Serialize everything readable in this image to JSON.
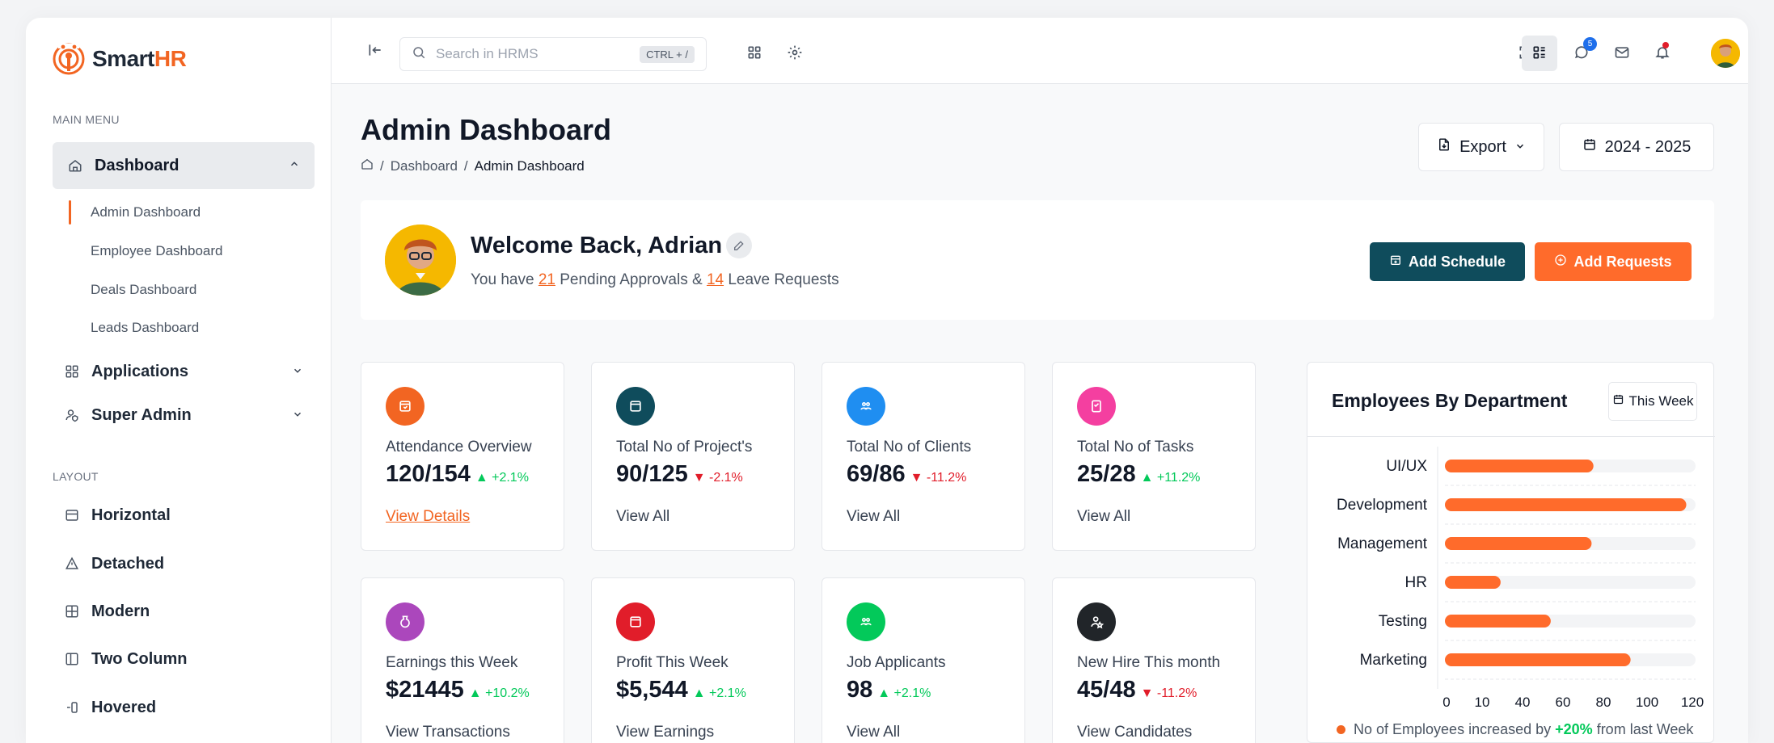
{
  "app": {
    "name_part1": "Smart",
    "name_part2": "HR"
  },
  "sidebar": {
    "main_menu_label": "MAIN MENU",
    "dashboard_label": "Dashboard",
    "dashboard_sub": [
      "Admin Dashboard",
      "Employee Dashboard",
      "Deals Dashboard",
      "Leads Dashboard"
    ],
    "applications_label": "Applications",
    "super_admin_label": "Super Admin",
    "layout_label": "LAYOUT",
    "layout_items": [
      "Horizontal",
      "Detached",
      "Modern",
      "Two Column",
      "Hovered"
    ]
  },
  "topbar": {
    "search_placeholder": "Search in HRMS",
    "search_shortcut": "CTRL + /",
    "chat_badge": "5"
  },
  "header": {
    "title": "Admin Dashboard",
    "breadcrumb": [
      "Dashboard",
      "Admin Dashboard"
    ],
    "export_label": "Export",
    "year_label": "2024 - 2025"
  },
  "welcome": {
    "title": "Welcome Back, Adrian",
    "sub_prefix": "You have ",
    "pending_count": "21",
    "sub_mid": " Pending Approvals & ",
    "leave_count": "14",
    "sub_suffix": " Leave Requests",
    "add_schedule": "Add Schedule",
    "add_requests": "Add Requests"
  },
  "cards": [
    {
      "label": "Attendance Overview",
      "value": "120/154",
      "trend": "+2.1%",
      "direction": "up",
      "link": "View Details",
      "color": "#f26522"
    },
    {
      "label": "Total No of Project's",
      "value": "90/125",
      "trend": "-2.1%",
      "direction": "down",
      "link": "View All",
      "color": "#0f4c5c"
    },
    {
      "label": "Total No of Clients",
      "value": "69/86",
      "trend": "-11.2%",
      "direction": "down",
      "link": "View All",
      "color": "#1f8ef1"
    },
    {
      "label": "Total No of Tasks",
      "value": "25/28",
      "trend": "+11.2%",
      "direction": "up",
      "link": "View All",
      "color": "#f43fa0"
    },
    {
      "label": "Earnings this Week",
      "value": "$21445",
      "trend": "+10.2%",
      "direction": "up",
      "link": "View Transactions",
      "color": "#ab47bc"
    },
    {
      "label": "Profit This Week",
      "value": "$5,544",
      "trend": "+2.1%",
      "direction": "up",
      "link": "View Earnings",
      "color": "#e11d2a"
    },
    {
      "label": "Job Applicants",
      "value": "98",
      "trend": "+2.1%",
      "direction": "up",
      "link": "View All",
      "color": "#03c95a"
    },
    {
      "label": "New Hire This month",
      "value": "45/48",
      "trend": "-11.2%",
      "direction": "down",
      "link": "View Candidates",
      "color": "#212529"
    }
  ],
  "chart_data": {
    "type": "bar",
    "orientation": "horizontal",
    "title": "Employees By Department",
    "filter_label": "This Week",
    "categories": [
      "UI/UX",
      "Development",
      "Management",
      "HR",
      "Testing",
      "Marketing"
    ],
    "values": [
      80,
      130,
      79,
      30,
      57,
      100
    ],
    "xlim": [
      0,
      135
    ],
    "xticks": [
      0,
      10,
      40,
      60,
      80,
      100,
      120
    ],
    "bar_color": "#ff6b2b",
    "track_color": "#f3f4f6",
    "grid": true,
    "footer_prefix": "No of Employees increased by ",
    "footer_pct": "+20%",
    "footer_suffix": " from last Week"
  }
}
